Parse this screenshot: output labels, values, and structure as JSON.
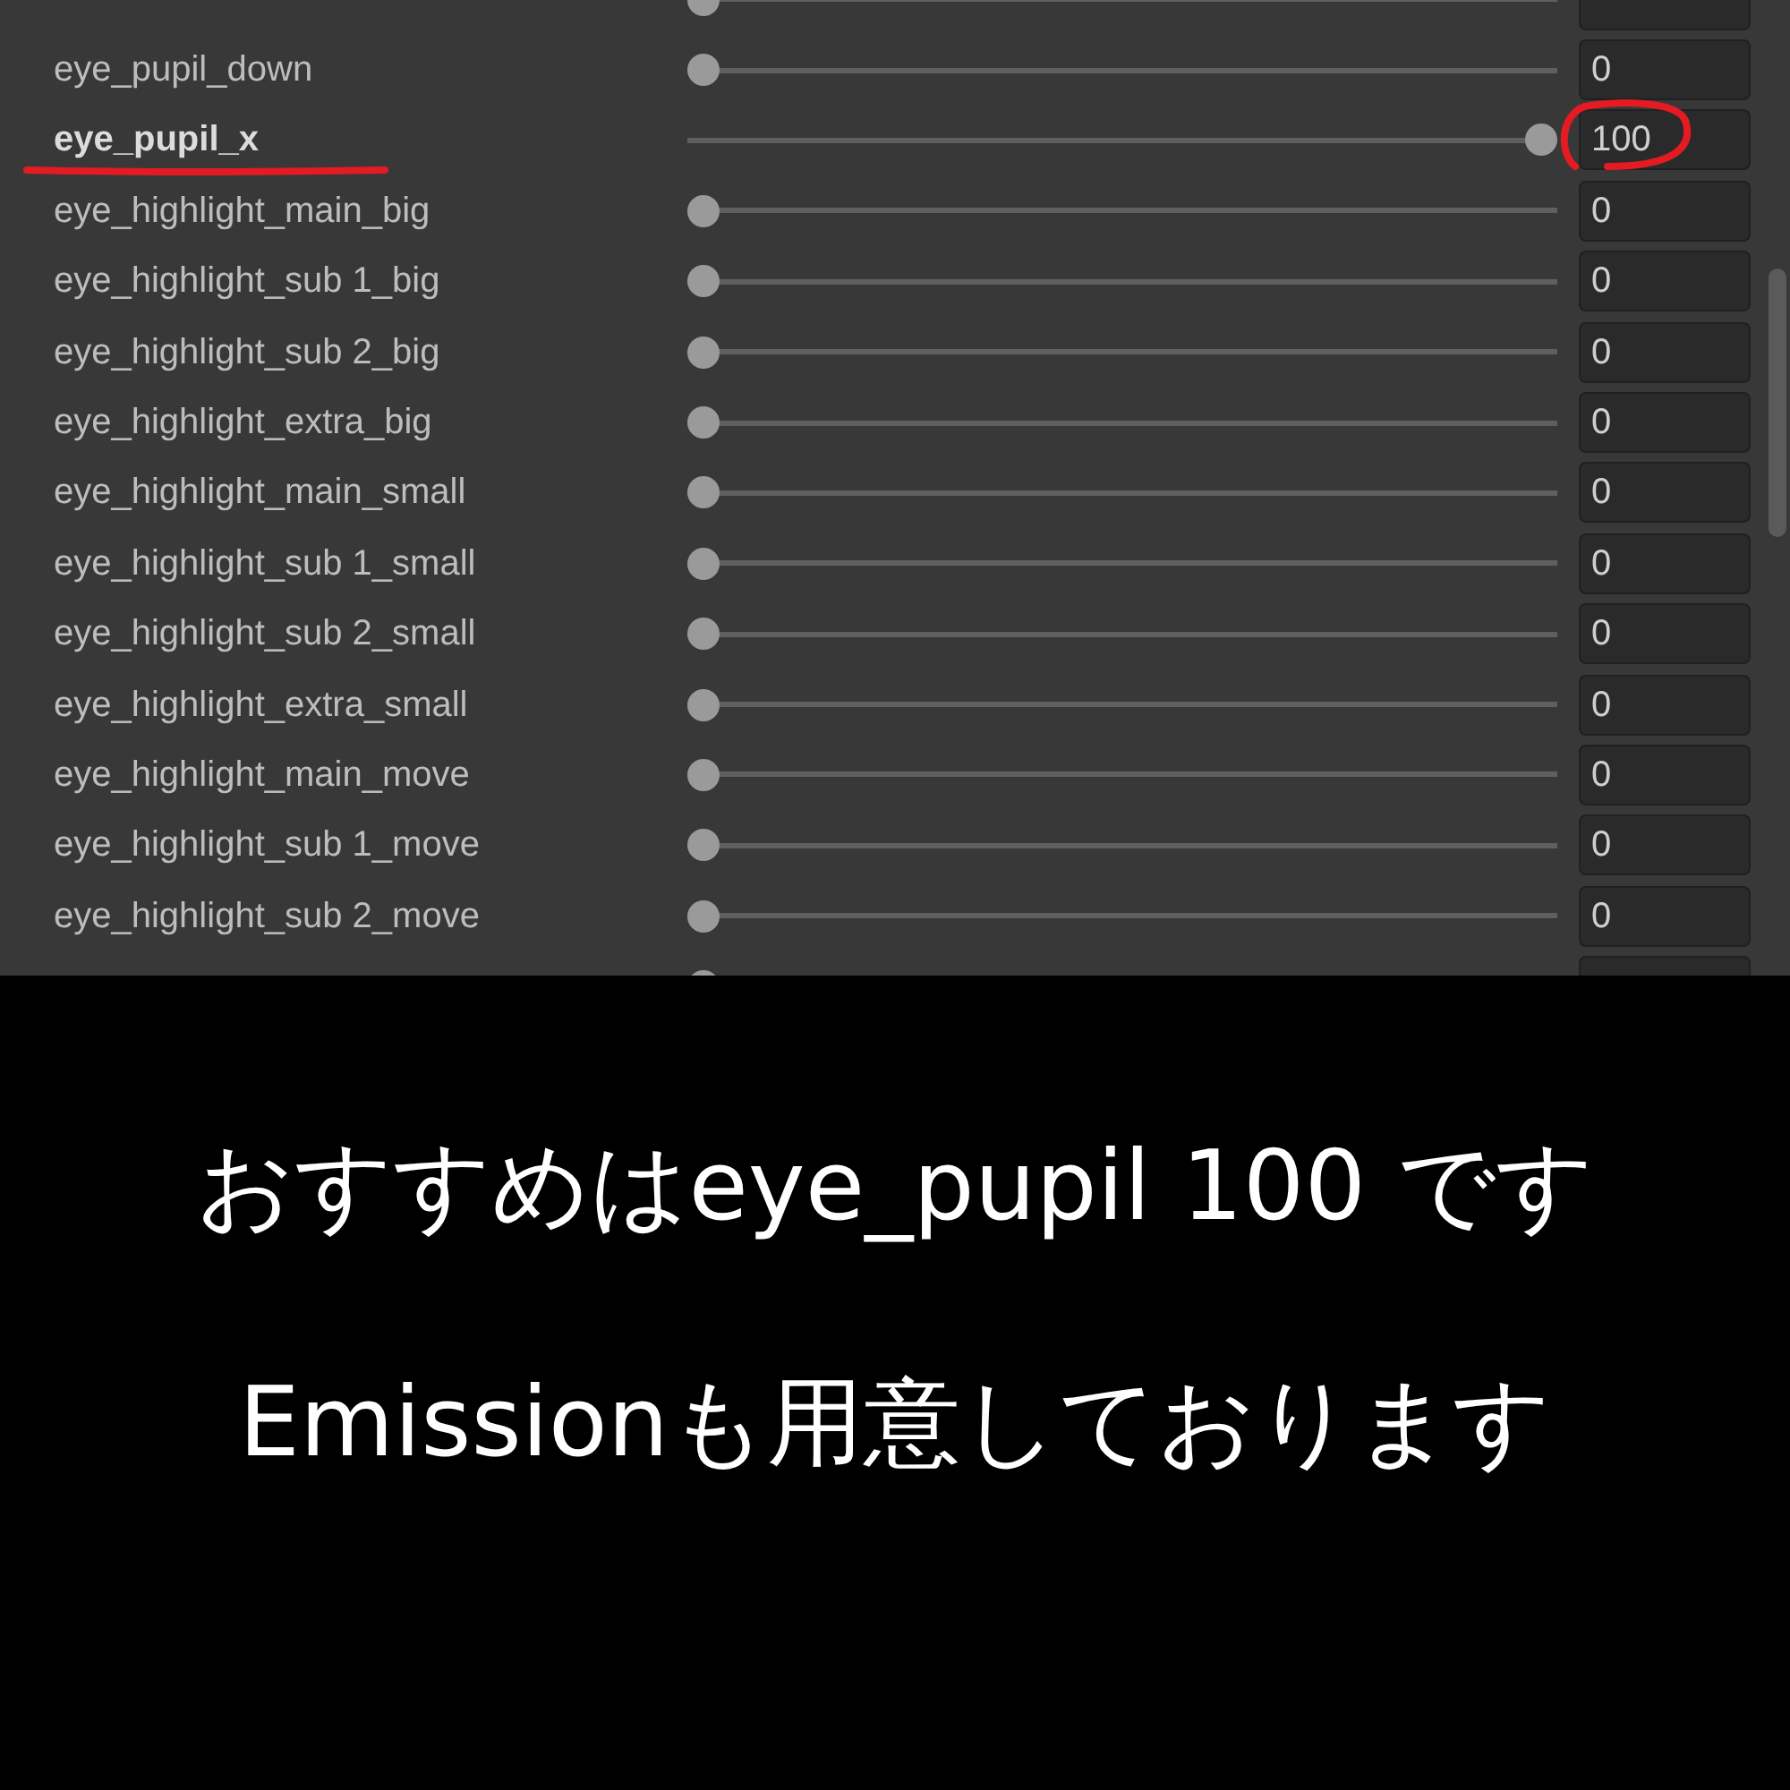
{
  "rows": [
    {
      "level": 0
    },
    {
      "label": "eye_pupil_down",
      "value": "0",
      "level": 0,
      "emphasized": false,
      "annotated": false
    },
    {
      "label": "eye_pupil_x",
      "value": "100",
      "level": 1,
      "emphasized": true,
      "annotated": true
    },
    {
      "label": "eye_highlight_main_big",
      "value": "0",
      "level": 0,
      "emphasized": false,
      "annotated": false
    },
    {
      "label": "eye_highlight_sub 1_big",
      "value": "0",
      "level": 0,
      "emphasized": false,
      "annotated": false
    },
    {
      "label": "eye_highlight_sub 2_big",
      "value": "0",
      "level": 0,
      "emphasized": false,
      "annotated": false
    },
    {
      "label": "eye_highlight_extra_big",
      "value": "0",
      "level": 0,
      "emphasized": false,
      "annotated": false
    },
    {
      "label": "eye_highlight_main_small",
      "value": "0",
      "level": 0,
      "emphasized": false,
      "annotated": false
    },
    {
      "label": "eye_highlight_sub 1_small",
      "value": "0",
      "level": 0,
      "emphasized": false,
      "annotated": false
    },
    {
      "label": "eye_highlight_sub 2_small",
      "value": "0",
      "level": 0,
      "emphasized": false,
      "annotated": false
    },
    {
      "label": "eye_highlight_extra_small",
      "value": "0",
      "level": 0,
      "emphasized": false,
      "annotated": false
    },
    {
      "label": "eye_highlight_main_move",
      "value": "0",
      "level": 0,
      "emphasized": false,
      "annotated": false
    },
    {
      "label": "eye_highlight_sub 1_move",
      "value": "0",
      "level": 0,
      "emphasized": false,
      "annotated": false
    },
    {
      "label": "eye_highlight_sub 2_move",
      "value": "0",
      "level": 0,
      "emphasized": false,
      "annotated": false
    },
    {
      "level": 0
    }
  ],
  "captions": [
    "おすすめはeye_pupil 100 です",
    "Emissionも用意しております"
  ]
}
